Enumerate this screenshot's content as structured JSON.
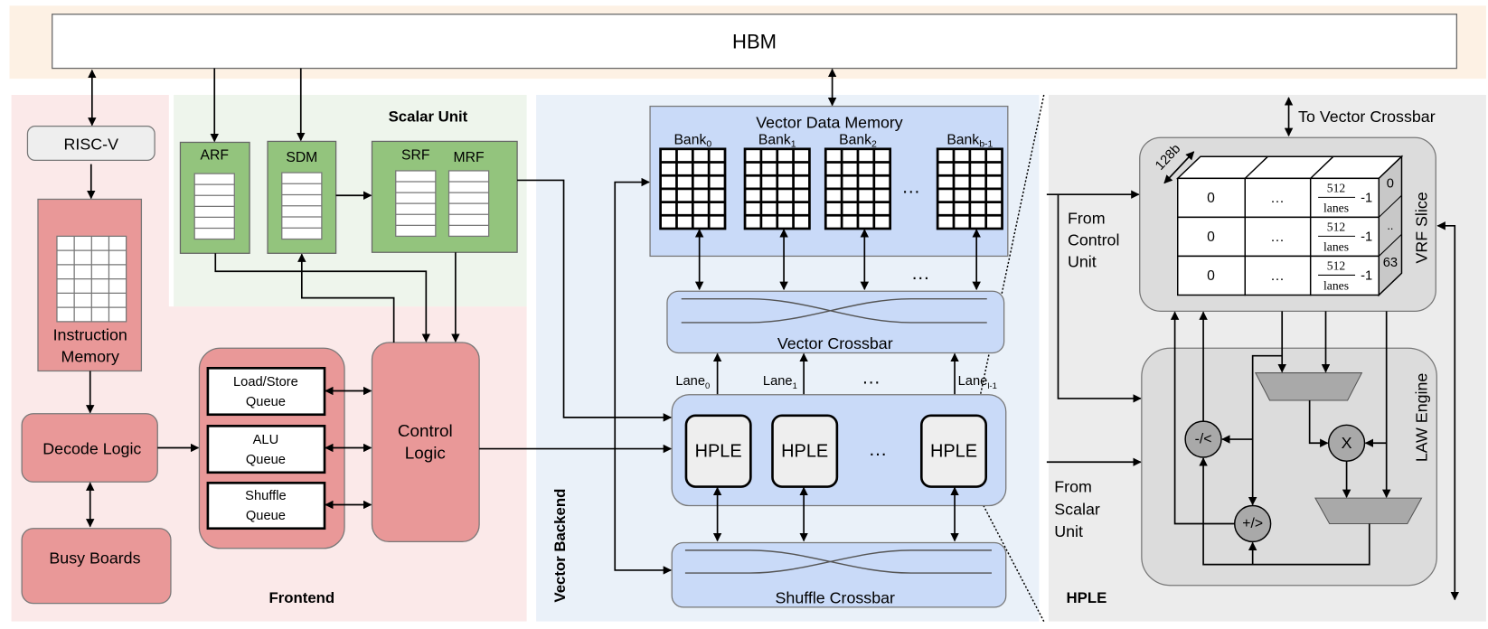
{
  "hbm": "HBM",
  "frontend": {
    "label": "Frontend",
    "riscv": "RISC-V",
    "imem": [
      "Instruction",
      "Memory"
    ],
    "decode": "Decode Logic",
    "busy": "Busy Boards",
    "queues": [
      [
        "Load/Store",
        "Queue"
      ],
      [
        "ALU",
        "Queue"
      ],
      [
        "Shuffle",
        "Queue"
      ]
    ],
    "control": [
      "Control",
      "Logic"
    ]
  },
  "scalar": {
    "label": "Scalar Unit",
    "arf": "ARF",
    "sdm": "SDM",
    "srf": "SRF",
    "mrf": "MRF"
  },
  "vector": {
    "label": "Vector Backend",
    "vdm": "Vector Data Memory",
    "banks": [
      {
        "base": "Bank",
        "sub": "0"
      },
      {
        "base": "Bank",
        "sub": "1"
      },
      {
        "base": "Bank",
        "sub": "2"
      },
      {
        "base": "Bank",
        "sub": "b-1"
      }
    ],
    "ellipsis": "…",
    "vcrossbar": "Vector Crossbar",
    "lanes": [
      {
        "base": "Lane",
        "sub": "0"
      },
      {
        "base": "Lane",
        "sub": "1"
      },
      {
        "base": "Lane",
        "sub": "l-1"
      }
    ],
    "hple": "HPLE",
    "shuffle": "Shuffle Crossbar"
  },
  "hple": {
    "label": "HPLE",
    "to_crossbar": "To Vector Crossbar",
    "from_control": [
      "From",
      "Control",
      "Unit"
    ],
    "from_scalar": [
      "From",
      "Scalar",
      "Unit"
    ],
    "vrf_slice": "VRF Slice",
    "width": "128b",
    "cell_first": "0",
    "cell_mid": "…",
    "frac_num": "512",
    "frac_den": "lanes",
    "frac_suffix": "-1",
    "depth_labels": [
      "0",
      "..",
      "63"
    ],
    "law_engine": "LAW Engine",
    "op_sub": "-/<",
    "op_add": "+/>",
    "op_mul": "X"
  },
  "colors": {
    "hbm_band": "#fdf1e4",
    "frontend_bg": "#fbe9e9",
    "frontend_block": "#e99898",
    "scalar_bg": "#eef5ec",
    "scalar_block": "#93c47d",
    "vector_bg": "#eaf1f9",
    "vector_block": "#c9daf8",
    "hple_bg": "#ececec",
    "hple_block": "#dcdcdc",
    "alu": "#a9a9a9"
  }
}
